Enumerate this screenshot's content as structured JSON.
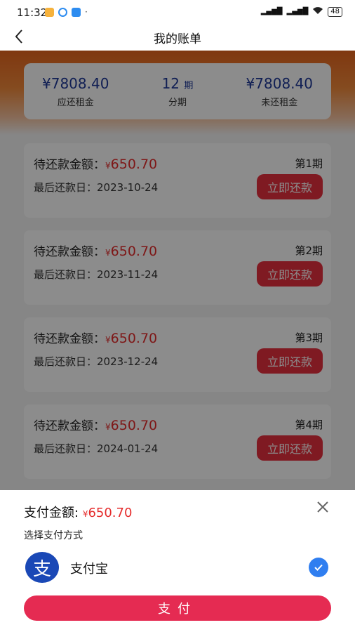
{
  "status_bar": {
    "time": "11:32",
    "battery": "48"
  },
  "nav": {
    "title": "我的账单"
  },
  "summary": {
    "payable": {
      "value": "¥7808.40",
      "label": "应还租金"
    },
    "periods": {
      "value": "12",
      "unit": "期",
      "label": "分期"
    },
    "unpaid": {
      "value": "¥7808.40",
      "label": "未还租金"
    }
  },
  "bills": [
    {
      "due_label": "待还款金额：",
      "currency": "¥",
      "amount": "650.70",
      "date_label": "最后还款日：",
      "date": "2023-10-24",
      "period": "第1期",
      "button": "立即还款"
    },
    {
      "due_label": "待还款金额：",
      "currency": "¥",
      "amount": "650.70",
      "date_label": "最后还款日：",
      "date": "2023-11-24",
      "period": "第2期",
      "button": "立即还款"
    },
    {
      "due_label": "待还款金额：",
      "currency": "¥",
      "amount": "650.70",
      "date_label": "最后还款日：",
      "date": "2023-12-24",
      "period": "第3期",
      "button": "立即还款"
    },
    {
      "due_label": "待还款金额：",
      "currency": "¥",
      "amount": "650.70",
      "date_label": "最后还款日：",
      "date": "2024-01-24",
      "period": "第4期",
      "button": "立即还款"
    }
  ],
  "sheet": {
    "title": "支付金额:",
    "currency": "¥",
    "amount": "650.70",
    "subtitle": "选择支付方式",
    "method_logo": "支",
    "method": "支付宝",
    "submit": "支付"
  },
  "colors": {
    "accent": "#e8313f",
    "amount": "#e52c2c",
    "brand_blue": "#1f3a9a",
    "alipay": "#1a48b6"
  }
}
